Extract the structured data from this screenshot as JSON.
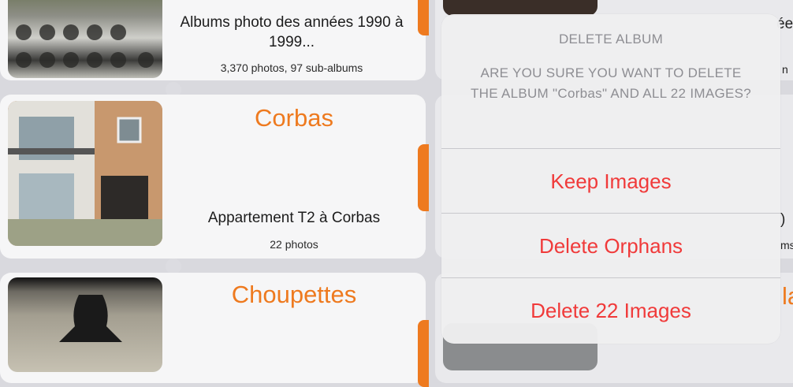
{
  "left_list": {
    "albums": [
      {
        "name": "",
        "description": "Albums photo des années 1990 à 1999...",
        "count": "3,370 photos, 97 sub-albums"
      },
      {
        "name": "Corbas",
        "description": "Appartement T2 à Corbas",
        "count": "22 photos"
      },
      {
        "name": "Choupettes",
        "description": "",
        "count": ""
      }
    ]
  },
  "right_list": {
    "partial_texts": [
      "ée",
      "n",
      ")",
      "ms",
      "la"
    ]
  },
  "alert": {
    "title": "DELETE ALBUM",
    "message": "ARE YOU SURE YOU WANT TO DELETE THE ALBUM \"Corbas\" AND ALL 22 IMAGES?",
    "actions": [
      "Keep Images",
      "Delete Orphans",
      "Delete 22 Images"
    ]
  },
  "colors": {
    "accent": "#ee7a1f",
    "destructive": "#f03a3a"
  }
}
